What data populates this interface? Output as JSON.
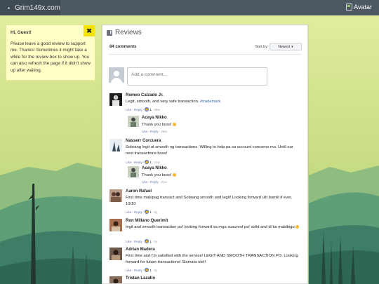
{
  "nav": {
    "brand": "Grim149x.com",
    "avatar_label": "Avatar"
  },
  "notice": {
    "greeting": "Hi, Guest!",
    "message": "Please leave a good review to support me. Thanks! Sometimes it might take a while for the review box to show up. You can also refresh the page if it didn't show up after waiting.",
    "close_glyph": "✖"
  },
  "reviews": {
    "title": "Reviews",
    "count": "84 comments",
    "sort_label": "Sort by",
    "sort_value": "Newest",
    "placeholder": "Add a comment..."
  },
  "meta": {
    "like": "Like",
    "reply": "Reply",
    "sep": "·"
  },
  "comments": [
    {
      "name": "Romeo Calzado Jr.",
      "text": "Legit, smooth, and very safe transaction. ",
      "hashtag": "#trademark",
      "likes": "1",
      "ago": "29w"
    },
    {
      "name": "Acaya Nikko",
      "text": "Thank you boss!",
      "emoji": true,
      "ago": "29w",
      "reply": true
    },
    {
      "name": "Nasserr Corcuera",
      "text": "Sobrang legit at smooth ng transactions. Willing to help pa sa account concerns mo. Until our next transactions boss!",
      "likes": "1",
      "ago": "31w"
    },
    {
      "name": "Acaya Nikko",
      "text": "Thank you boss!",
      "emoji": true,
      "ago": "31w",
      "reply": true
    },
    {
      "name": "Aaron Rafael",
      "text": "First time makipag transact and Sobrang smooth and legit! Looking forward ulit bumili if ever. 10/10",
      "likes": "1",
      "ago": "2y"
    },
    {
      "name": "Ron Millano Querimit",
      "text": "legit and smooth transaction po! looking forward sa mga susunod pa! solid and di ka mabibigo",
      "emoji": true,
      "likes": "1",
      "ago": "2y"
    },
    {
      "name": "Adrian Madera",
      "text": "First time and I'm satisfied with the service! LEGIT AND SMOOTH TRANSACTION PO. Looking forward for future transactions! Slamata ulet!",
      "likes": "1",
      "ago": "2y"
    },
    {
      "name": "Tristan Lazatin",
      "text": ""
    }
  ]
}
